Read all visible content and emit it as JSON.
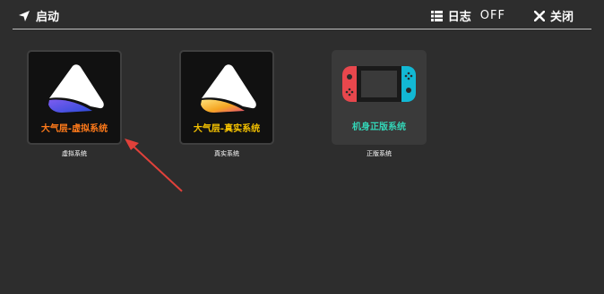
{
  "topbar": {
    "launch_label": "启动",
    "log_label": "日志",
    "log_state": "OFF",
    "close_label": "关闭"
  },
  "tiles": [
    {
      "title": "大气层-虚拟系统",
      "caption": "虚拟系统",
      "title_color": "#ff7a1a"
    },
    {
      "title": "大气层-真实系统",
      "caption": "真实系统",
      "title_color": "#f5c200"
    },
    {
      "title": "机身正版系统",
      "caption": "正版系统",
      "title_color": "#33d6b8"
    }
  ],
  "colors": {
    "background": "#2d2d2d",
    "arrow": "#e0413a",
    "joycon_left": "#e8474d",
    "joycon_right": "#12b8d4"
  },
  "icons": [
    "navigation-arrow-icon",
    "list-icon",
    "close-icon",
    "atmosphere-logo-icon",
    "switch-console-icon"
  ]
}
